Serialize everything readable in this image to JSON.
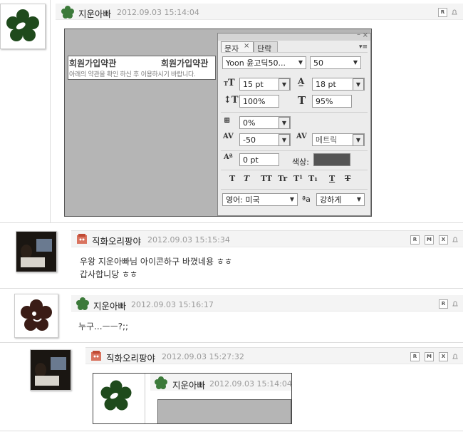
{
  "comments": [
    {
      "author": "지운아빠",
      "date": "2012.09.03 15:14:04",
      "buttons": [
        "R"
      ],
      "screenshot": {
        "canvas_text_title_1": "회원가입약관",
        "canvas_text_title_2": "회원가입약관",
        "canvas_text_sub": "아래의 약관을 확인 하신 후 이용하시기 바랍니다.",
        "panel": {
          "tab_char": "문자",
          "tab_close": "×",
          "tab_para": "단락",
          "font_family": "Yoon 윤고딕50...",
          "font_style": "50",
          "font_size": "15 pt",
          "leading": "18 pt",
          "vertical_scale": "100%",
          "horizontal_scale": "95%",
          "tsume": "0%",
          "tracking": "-50",
          "kerning": "메트릭",
          "baseline_shift": "0 pt",
          "color_label": "색상:",
          "color_swatch": "#555555",
          "style_buttons": [
            "T",
            "T",
            "TT",
            "Tr",
            "T¹",
            "T₁",
            "T",
            "T"
          ],
          "language": "영어: 미국",
          "aa_label": "ªa",
          "antialias": "강하게"
        }
      }
    },
    {
      "author": "직화오리팡야",
      "date": "2012.09.03 15:15:34",
      "buttons": [
        "R",
        "M",
        "X"
      ],
      "lines": [
        "우왕 지운아빠님 아이콘하구 바꼈네용 ㅎㅎ",
        "갑사합니당 ㅎㅎ"
      ]
    },
    {
      "author": "지운아빠",
      "date": "2012.09.03 15:16:17",
      "buttons": [
        "R"
      ],
      "lines": [
        "누구...ㅡㅡ?;;"
      ]
    },
    {
      "author": "직화오리팡야",
      "date": "2012.09.03 15:27:32",
      "buttons": [
        "R",
        "M",
        "X"
      ],
      "quote": {
        "author": "지운아빠",
        "date": "2012.09.03 15:14:04"
      }
    }
  ],
  "colors": {
    "flower_green": "#1f4a1c",
    "flower_dark": "#3a1c16",
    "icon_green": "#3c7a3a",
    "icon_pink": "#d9735f",
    "canvas_gray": "#b5b5b5"
  }
}
